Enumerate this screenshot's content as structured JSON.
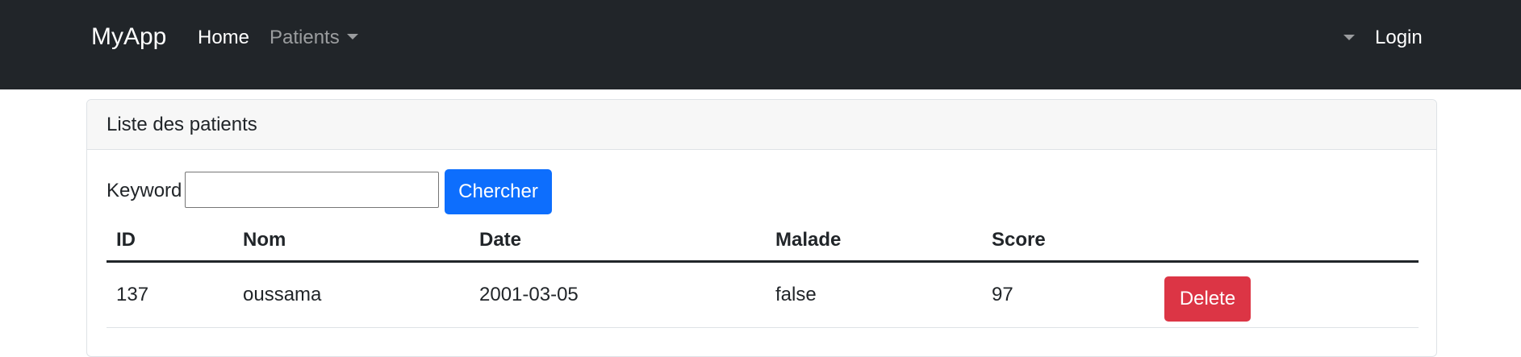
{
  "navbar": {
    "brand": "MyApp",
    "home_label": "Home",
    "patients_label": "Patients",
    "login_label": "Login"
  },
  "card": {
    "header": "Liste des patients",
    "search": {
      "label": "Keyword",
      "value": "",
      "button_label": "Chercher"
    },
    "table": {
      "columns": [
        "ID",
        "Nom",
        "Date",
        "Malade",
        "Score",
        ""
      ],
      "rows": [
        {
          "id": "137",
          "nom": "oussama",
          "date": "2001-03-05",
          "malade": "false",
          "score": "97",
          "action_label": "Delete"
        }
      ]
    }
  },
  "colors": {
    "navbar_bg": "#212529",
    "primary": "#0d6efd",
    "danger": "#dc3545"
  }
}
